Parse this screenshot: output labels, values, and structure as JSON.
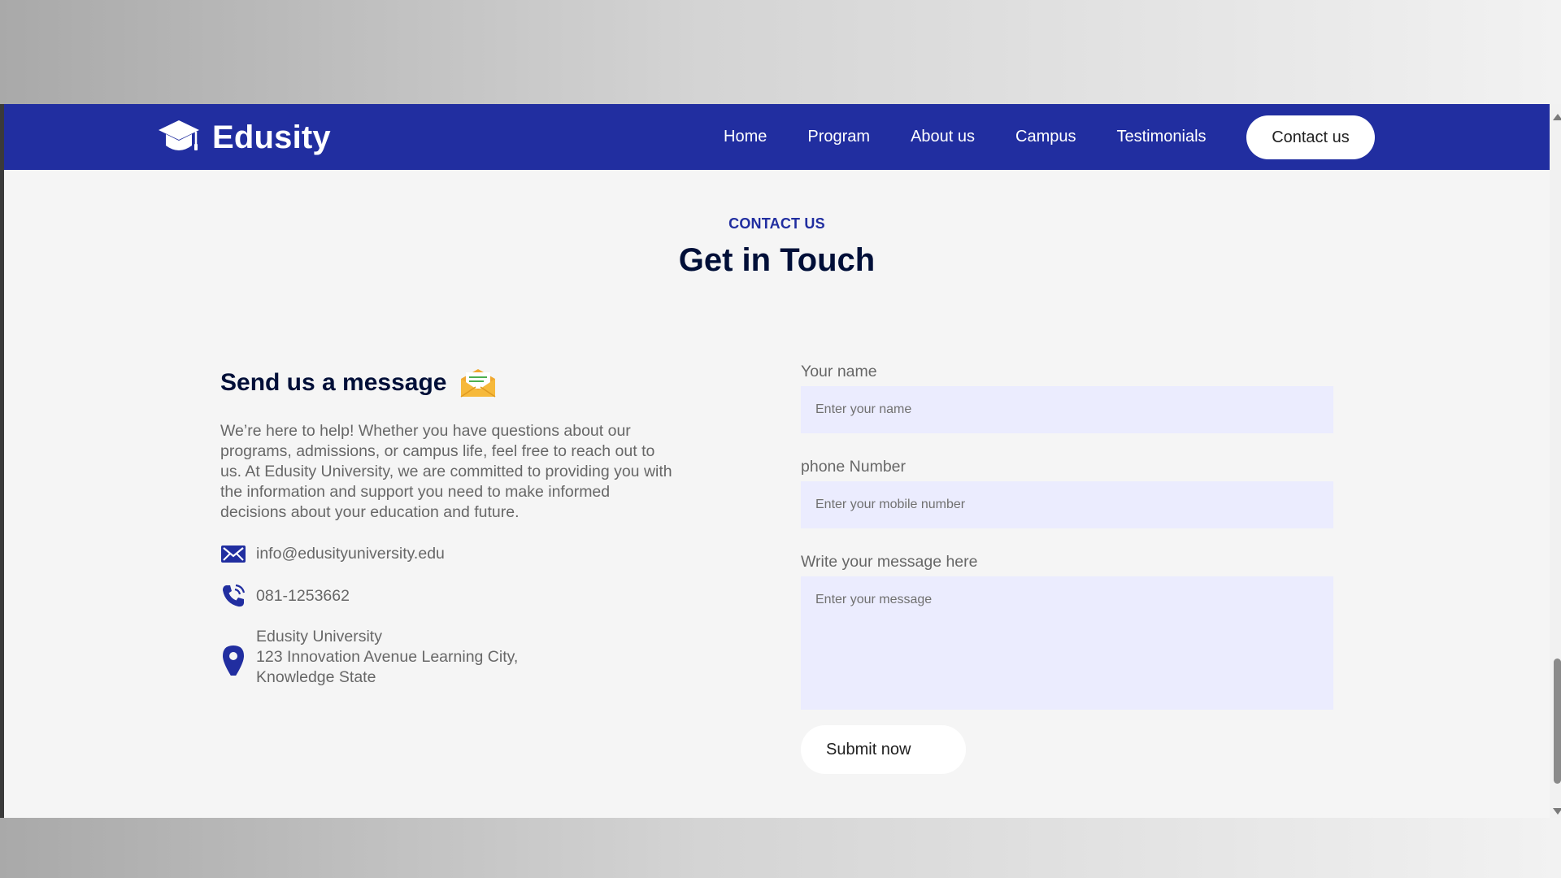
{
  "brand": {
    "name": "Edusity",
    "logo_icon": "graduation-cap-icon"
  },
  "nav": {
    "links": [
      "Home",
      "Program",
      "About us",
      "Campus",
      "Testimonials"
    ],
    "cta_label": "Contact us"
  },
  "section": {
    "subtitle": "CONTACT US",
    "title": "Get in Touch"
  },
  "contact_info": {
    "heading": "Send us a message",
    "heading_icon": "envelope-icon",
    "description": "We’re here to help! Whether you have questions about our programs, admissions, or campus life, feel free to reach out to us. At Edusity University, we are committed to providing you with the information and support you need to make informed decisions about your education and future.",
    "email": "info@edusityuniversity.edu",
    "phone": "081-1253662",
    "address": {
      "line1": "Edusity University",
      "line2": "123 Innovation Avenue Learning City,",
      "line3": "Knowledge State"
    }
  },
  "form": {
    "name_label": "Your name",
    "name_placeholder": "Enter your name",
    "phone_label": "phone Number",
    "phone_placeholder": "Enter your mobile number",
    "message_label": "Write your message here",
    "message_placeholder": "Enter your message",
    "submit_label": "Submit now"
  },
  "colors": {
    "brand_blue": "#212ea0",
    "heading_navy": "#000f38",
    "input_bg": "#ebecfe",
    "body_text": "#676767"
  }
}
